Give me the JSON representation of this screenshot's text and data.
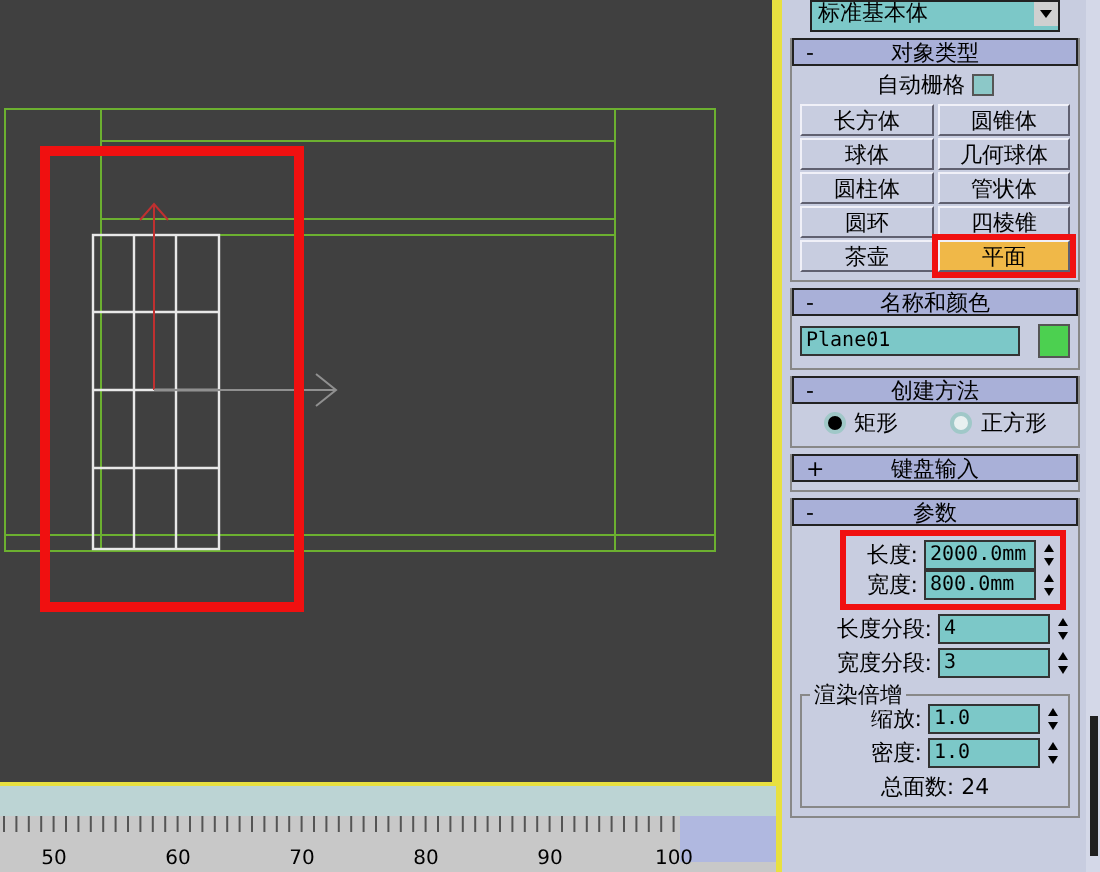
{
  "viewport": {
    "ruler_labels": [
      "50",
      "60",
      "70",
      "80",
      "90",
      "100"
    ]
  },
  "command_panel": {
    "dropdown": "标准基本体",
    "rollouts": [
      {
        "kind": "object_type",
        "toggle": "-",
        "title": "对象类型",
        "autogrid": {
          "label": "自动栅格",
          "checked": false
        },
        "buttons": [
          {
            "label": "长方体",
            "selected": false,
            "annotated": false
          },
          {
            "label": "圆锥体",
            "selected": false,
            "annotated": false
          },
          {
            "label": "球体",
            "selected": false,
            "annotated": false
          },
          {
            "label": "几何球体",
            "selected": false,
            "annotated": false
          },
          {
            "label": "圆柱体",
            "selected": false,
            "annotated": false
          },
          {
            "label": "管状体",
            "selected": false,
            "annotated": false
          },
          {
            "label": "圆环",
            "selected": false,
            "annotated": false
          },
          {
            "label": "四棱锥",
            "selected": false,
            "annotated": false
          },
          {
            "label": "茶壶",
            "selected": false,
            "annotated": false
          },
          {
            "label": "平面",
            "selected": true,
            "annotated": true
          }
        ]
      },
      {
        "kind": "name_color",
        "toggle": "-",
        "title": "名称和颜色",
        "name": "Plane01",
        "color": "#4cd050"
      },
      {
        "kind": "creation_method",
        "toggle": "-",
        "title": "创建方法",
        "options": [
          {
            "label": "矩形",
            "selected": true
          },
          {
            "label": "正方形",
            "selected": false
          }
        ]
      },
      {
        "kind": "collapsed",
        "toggle": "+",
        "title": "键盘输入"
      },
      {
        "kind": "parameters",
        "toggle": "-",
        "title": "参数",
        "annotated_fields": [
          {
            "label": "长度:",
            "value": "2000.0mm"
          },
          {
            "label": "宽度:",
            "value": "800.0mm"
          }
        ],
        "fields": [
          {
            "label": "长度分段:",
            "value": "4"
          },
          {
            "label": "宽度分段:",
            "value": "3"
          }
        ],
        "render_multipliers": {
          "title": "渲染倍增",
          "fields": [
            {
              "label": "缩放:",
              "value": "1.0"
            },
            {
              "label": "密度:",
              "value": "1.0"
            }
          ]
        },
        "total": "总面数: 24"
      }
    ]
  }
}
